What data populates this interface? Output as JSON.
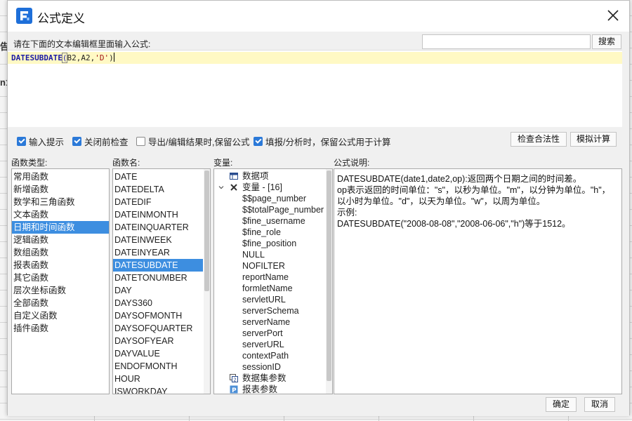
{
  "background": {
    "cell_left_top": "告",
    "cell_left_mid": "n1"
  },
  "dialog": {
    "title": "公式定义",
    "prompt_label": "请在下面的文本编辑框里面输入公式:",
    "search_input_value": "",
    "search_button_label": "搜索",
    "formula": {
      "fn": "DATESUBDATE",
      "open_paren": "(",
      "args": "B2,A2,",
      "str_arg": "'D'",
      "close_paren": ")"
    },
    "options": [
      {
        "label": "输入提示",
        "checked": true
      },
      {
        "label": "关闭前检查",
        "checked": true
      },
      {
        "label": "导出/编辑结果时,保留公式",
        "checked": false
      },
      {
        "label": "填报/分析时，保留公式用于计算",
        "checked": true
      }
    ],
    "check_button_label": "检查合法性",
    "simulate_button_label": "模拟计算",
    "categories_label": "函数类型:",
    "categories": [
      "常用函数",
      "新增函数",
      "数学和三角函数",
      "文本函数",
      "日期和时间函数",
      "逻辑函数",
      "数组函数",
      "报表函数",
      "其它函数",
      "层次坐标函数",
      "全部函数",
      "自定义函数",
      "插件函数"
    ],
    "selected_category": "日期和时间函数",
    "functions_label": "函数名:",
    "functions": [
      "DATE",
      "DATEDELTA",
      "DATEDIF",
      "DATEINMONTH",
      "DATEINQUARTER",
      "DATEINWEEK",
      "DATEINYEAR",
      "DATESUBDATE",
      "DATETONUMBER",
      "DAY",
      "DAYS360",
      "DAYSOFMONTH",
      "DAYSOFQUARTER",
      "DAYSOFYEAR",
      "DAYVALUE",
      "ENDOFMONTH",
      "HOUR",
      "ISWORKDAY"
    ],
    "selected_function": "DATESUBDATE",
    "variables_label": "变量:",
    "variables": {
      "data_item": "数据项",
      "var_group": "变量 - [16]",
      "var_items": [
        "$$page_number",
        "$$totalPage_number",
        "$fine_username",
        "$fine_role",
        "$fine_position",
        "NULL",
        "NOFILTER",
        "reportName",
        "formletName",
        "servletURL",
        "serverSchema",
        "serverName",
        "serverPort",
        "serverURL",
        "contextPath",
        "sessionID"
      ],
      "dataset_params": "数据集参数",
      "report_params": "报表参数"
    },
    "description_label": "公式说明:",
    "description_lines": [
      "DATESUBDATE(date1,date2,op):返回两个日期之间的时间差。",
      "op表示返回的时间单位：\"s\"，以秒为单位。\"m\"，以分钟为单位。\"h\"，以小时为单位。\"d\"，以天为单位。\"w\"，以周为单位。",
      "示例:",
      "DATESUBDATE(\"2008-08-08\",\"2008-06-06\",\"h\")等于1512。"
    ],
    "ok_button_label": "确定",
    "cancel_button_label": "取消"
  },
  "colors": {
    "accent": "#3d8ee0",
    "checkbox": "#2b79d8",
    "editor_highlight": "#fff9c4"
  }
}
